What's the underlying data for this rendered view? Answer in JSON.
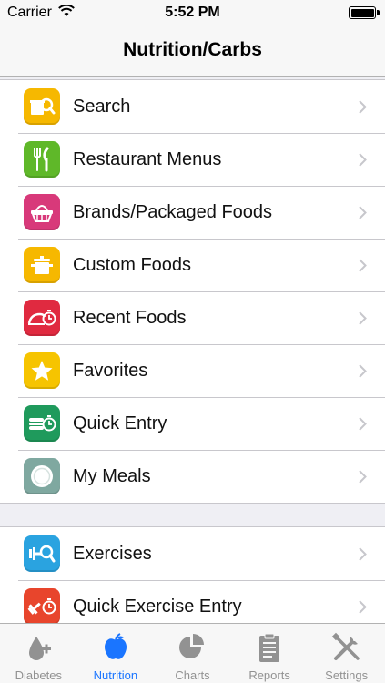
{
  "status_bar": {
    "carrier": "Carrier",
    "time": "5:52 PM"
  },
  "nav": {
    "title": "Nutrition/Carbs"
  },
  "food_menu": [
    {
      "label": "Search",
      "icon": "search-food-icon",
      "color": "#f6b800"
    },
    {
      "label": "Restaurant Menus",
      "icon": "fork-knife-icon",
      "color": "#5fb829"
    },
    {
      "label": "Brands/Packaged Foods",
      "icon": "basket-icon",
      "color": "#d8397a"
    },
    {
      "label": "Custom Foods",
      "icon": "pot-icon",
      "color": "#f6b800"
    },
    {
      "label": "Recent Foods",
      "icon": "recent-food-icon",
      "color": "#e02a40"
    },
    {
      "label": "Favorites",
      "icon": "star-icon",
      "color": "#f6c400"
    },
    {
      "label": "Quick Entry",
      "icon": "quick-entry-icon",
      "color": "#1f9a5c"
    },
    {
      "label": "My Meals",
      "icon": "plate-icon",
      "color": "#7fa8a0"
    }
  ],
  "exercise_menu": [
    {
      "label": "Exercises",
      "icon": "dumbbell-search-icon",
      "color": "#2aa3e0"
    },
    {
      "label": "Quick Exercise Entry",
      "icon": "quick-exercise-icon",
      "color": "#e8452c"
    }
  ],
  "tabs": [
    {
      "label": "Diabetes",
      "icon": "diabetes-icon",
      "active": false
    },
    {
      "label": "Nutrition",
      "icon": "apple-icon",
      "active": true
    },
    {
      "label": "Charts",
      "icon": "pie-chart-icon",
      "active": false
    },
    {
      "label": "Reports",
      "icon": "clipboard-icon",
      "active": false
    },
    {
      "label": "Settings",
      "icon": "tools-icon",
      "active": false
    }
  ],
  "colors": {
    "tint": "#1a75ff",
    "inactive_tab": "#929292",
    "separator": "#c8c7cc",
    "chevron": "#c7c7cc"
  }
}
